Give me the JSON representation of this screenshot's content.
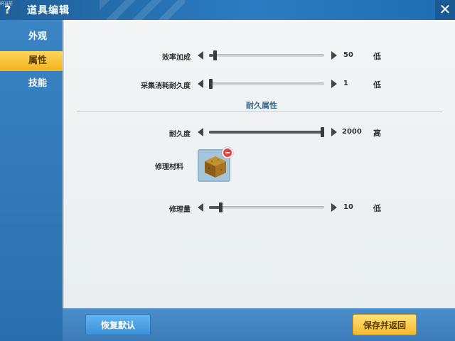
{
  "window": {
    "title": "道具编辑",
    "small_label": "码当前",
    "help_icon": "question-icon",
    "close_icon": "close-icon"
  },
  "sidebar": {
    "items": [
      {
        "label": "外观",
        "active": false
      },
      {
        "label": "属性",
        "active": true
      },
      {
        "label": "技能",
        "active": false
      }
    ]
  },
  "main": {
    "efficiency": {
      "label": "效率加成",
      "value": "50",
      "level": "低",
      "fraction": 0.04
    },
    "durability_cost": {
      "label": "采集消耗耐久度",
      "value": "1",
      "level": "低",
      "fraction": 0.0
    },
    "section_title": "耐久属性",
    "durability": {
      "label": "耐久度",
      "value": "2000",
      "level": "高",
      "fraction": 1.0
    },
    "repair_material": {
      "label": "修理材料",
      "item_icon": "dirt-block-icon"
    },
    "repair_amount": {
      "label": "修理量",
      "value": "10",
      "level": "低",
      "fraction": 0.09
    }
  },
  "footer": {
    "reset_label": "恢复默认",
    "save_label": "保存并返回"
  },
  "colors": {
    "accent_yellow": "#f5b92b",
    "accent_blue": "#3c92d8",
    "panel_bg": "#eef2f4"
  }
}
